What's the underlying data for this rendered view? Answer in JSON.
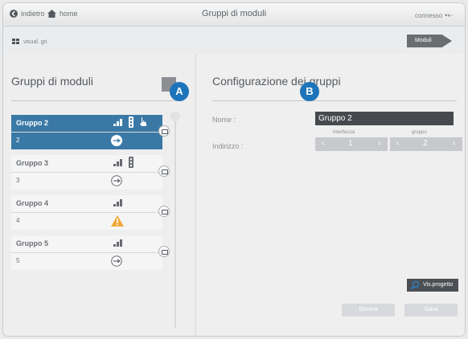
{
  "topbar": {
    "back_label": "indietro",
    "home_label": "home",
    "title": "Gruppi di moduli",
    "status": "connesso"
  },
  "subbar": {
    "view_label": "visual. gri",
    "modules_button": "Moduli"
  },
  "left_panel": {
    "title": "Gruppi di moduli",
    "groups": [
      {
        "name": "Gruppo 2",
        "address": "2"
      },
      {
        "name": "Gruppo 3",
        "address": "3"
      },
      {
        "name": "Gruppo 4",
        "address": "4"
      },
      {
        "name": "Gruppo 5",
        "address": "5"
      }
    ]
  },
  "right_panel": {
    "title": "Configurazione dei gruppi",
    "name_label": "Nome :",
    "name_value": "Gruppo 2",
    "address_label": "Indirizzo :",
    "interface_label": "interfaccia",
    "interface_value": "1",
    "group_label": "gruppo",
    "group_value": "2",
    "view_project_button": "Vis.progetto",
    "delete_button": "Elimina",
    "save_button": "Salva"
  },
  "markers": {
    "a": "A",
    "b": "B"
  },
  "colors": {
    "accent": "#3a79a6",
    "badge": "#1d74ba",
    "warning": "#f0a83a"
  }
}
